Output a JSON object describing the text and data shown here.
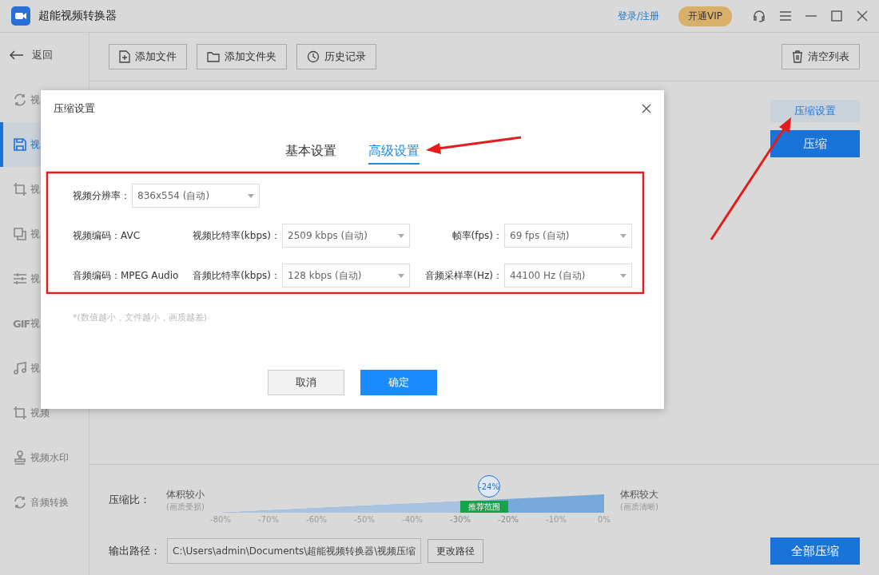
{
  "window": {
    "title": "超能视频转换器",
    "login": "登录/注册",
    "vip": "开通VIP"
  },
  "sidebar": {
    "back": "返回",
    "items": [
      {
        "kind": "rotate",
        "label": "视",
        "selected": false
      },
      {
        "kind": "save",
        "label": "视",
        "selected": true
      },
      {
        "kind": "crop",
        "label": "视",
        "selected": false
      },
      {
        "kind": "layers",
        "label": "视",
        "selected": false
      },
      {
        "kind": "sliders",
        "label": "视",
        "selected": false
      },
      {
        "kind": "gif",
        "icon_text": "GIF",
        "label": "视",
        "selected": false
      },
      {
        "kind": "music",
        "label": "视",
        "selected": false
      },
      {
        "kind": "crop",
        "label": "视频",
        "selected": false
      },
      {
        "kind": "stamp",
        "label": "视频水印",
        "selected": false
      },
      {
        "kind": "rotate",
        "label": "音频转换",
        "selected": false
      }
    ]
  },
  "toolbar": {
    "buttons": [
      {
        "label": "添加文件"
      },
      {
        "label": "添加文件夹"
      },
      {
        "label": "历史记录"
      }
    ],
    "clear": "清空列表"
  },
  "side_actions": {
    "settings": "压缩设置",
    "compress": "压缩"
  },
  "dialog": {
    "title": "压缩设置",
    "tabs": [
      {
        "label": "基本设置",
        "selected": false
      },
      {
        "label": "高级设置",
        "selected": true
      }
    ],
    "rows": [
      [
        {
          "kind": "select",
          "label": "视频分辨率：",
          "value": "836x554 (自动)"
        }
      ],
      [
        {
          "kind": "info",
          "label": "视频编码：",
          "value": "AVC"
        },
        {
          "kind": "select",
          "label": "视频比特率(kbps)：",
          "value": "2509 kbps (自动)"
        },
        {
          "kind": "select",
          "label": "帧率(fps)：",
          "value": "69 fps (自动)"
        }
      ],
      [
        {
          "kind": "info",
          "label": "音频编码：",
          "value": "MPEG Audio"
        },
        {
          "kind": "select",
          "label": "音频比特率(kbps)：",
          "value": "128 kbps (自动)"
        },
        {
          "kind": "select",
          "label": "音频采样率(Hz)：",
          "value": "44100 Hz (自动)"
        }
      ]
    ],
    "note": "*(数值越小，文件越小，画质越差)",
    "cancel": "取消",
    "ok": "确定"
  },
  "compression": {
    "label": "压缩比：",
    "left": "体积较小",
    "left_sub": "(画质受损)",
    "right": "体积较大",
    "right_sub": "(画质清晰)",
    "reading": "-24%",
    "level": 0.7,
    "recommend": "推荐范围",
    "ticks": [
      {
        "label": "-80%",
        "recommended": false
      },
      {
        "label": "-70%",
        "recommended": false
      },
      {
        "label": "-60%",
        "recommended": false
      },
      {
        "label": "-50%",
        "recommended": false
      },
      {
        "label": "-40%",
        "recommended": false
      },
      {
        "label": "-30%",
        "recommended": true
      },
      {
        "label": "-20%",
        "recommended": true
      },
      {
        "label": "-10%",
        "recommended": false
      },
      {
        "label": "0%",
        "recommended": false
      }
    ]
  },
  "output": {
    "label": "输出路径：",
    "path": "C:\\Users\\admin\\Documents\\超能视频转换器\\视频压缩",
    "change": "更改路径",
    "start": "全部压缩"
  }
}
